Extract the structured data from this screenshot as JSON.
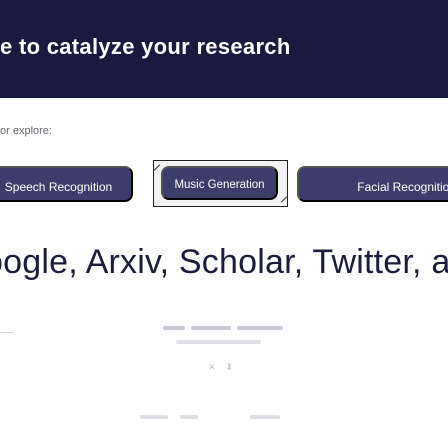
{
  "hero": {
    "title": "e to catalyze your research"
  },
  "explore": {
    "label": "or explore:"
  },
  "chips": [
    {
      "label": "Speech Recognition"
    },
    {
      "label": "Music Generation"
    },
    {
      "label": "Facial Recognition"
    }
  ],
  "sources": {
    "line": "oogle, Arxiv, Scholar, Twitter, and r"
  },
  "colors": {
    "hero_background": "#191a3f",
    "chip_background": "#3c3d6b",
    "chip_text": "#ffffff",
    "sources_text": "#1c1c3c"
  },
  "icons": {
    "close": "close-icon",
    "download": "download-icon"
  }
}
